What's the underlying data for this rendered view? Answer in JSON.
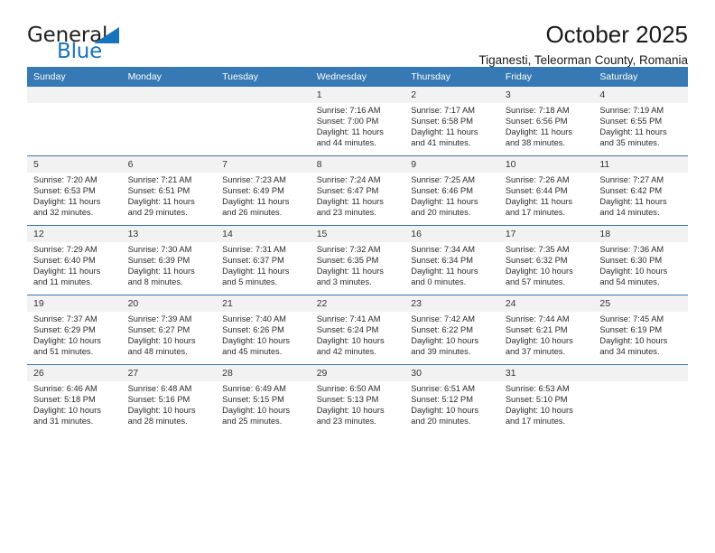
{
  "brand": {
    "name_part1": "General",
    "name_part2": "Blue",
    "accent_color": "#1574bb",
    "triangle_icon": "brand-triangle-icon"
  },
  "header": {
    "month_title": "October 2025",
    "location": "Tiganesti, Teleorman County, Romania"
  },
  "calendar": {
    "header_color": "#3679b4",
    "daynum_band_color": "#f2f2f2",
    "weekday_headers": [
      "Sunday",
      "Monday",
      "Tuesday",
      "Wednesday",
      "Thursday",
      "Friday",
      "Saturday"
    ],
    "weeks": [
      [
        {
          "day": "",
          "empty": true
        },
        {
          "day": "",
          "empty": true
        },
        {
          "day": "",
          "empty": true
        },
        {
          "day": "1",
          "sunrise": "Sunrise: 7:16 AM",
          "sunset": "Sunset: 7:00 PM",
          "daylight": "Daylight: 11 hours and 44 minutes."
        },
        {
          "day": "2",
          "sunrise": "Sunrise: 7:17 AM",
          "sunset": "Sunset: 6:58 PM",
          "daylight": "Daylight: 11 hours and 41 minutes."
        },
        {
          "day": "3",
          "sunrise": "Sunrise: 7:18 AM",
          "sunset": "Sunset: 6:56 PM",
          "daylight": "Daylight: 11 hours and 38 minutes."
        },
        {
          "day": "4",
          "sunrise": "Sunrise: 7:19 AM",
          "sunset": "Sunset: 6:55 PM",
          "daylight": "Daylight: 11 hours and 35 minutes."
        }
      ],
      [
        {
          "day": "5",
          "sunrise": "Sunrise: 7:20 AM",
          "sunset": "Sunset: 6:53 PM",
          "daylight": "Daylight: 11 hours and 32 minutes."
        },
        {
          "day": "6",
          "sunrise": "Sunrise: 7:21 AM",
          "sunset": "Sunset: 6:51 PM",
          "daylight": "Daylight: 11 hours and 29 minutes."
        },
        {
          "day": "7",
          "sunrise": "Sunrise: 7:23 AM",
          "sunset": "Sunset: 6:49 PM",
          "daylight": "Daylight: 11 hours and 26 minutes."
        },
        {
          "day": "8",
          "sunrise": "Sunrise: 7:24 AM",
          "sunset": "Sunset: 6:47 PM",
          "daylight": "Daylight: 11 hours and 23 minutes."
        },
        {
          "day": "9",
          "sunrise": "Sunrise: 7:25 AM",
          "sunset": "Sunset: 6:46 PM",
          "daylight": "Daylight: 11 hours and 20 minutes."
        },
        {
          "day": "10",
          "sunrise": "Sunrise: 7:26 AM",
          "sunset": "Sunset: 6:44 PM",
          "daylight": "Daylight: 11 hours and 17 minutes."
        },
        {
          "day": "11",
          "sunrise": "Sunrise: 7:27 AM",
          "sunset": "Sunset: 6:42 PM",
          "daylight": "Daylight: 11 hours and 14 minutes."
        }
      ],
      [
        {
          "day": "12",
          "sunrise": "Sunrise: 7:29 AM",
          "sunset": "Sunset: 6:40 PM",
          "daylight": "Daylight: 11 hours and 11 minutes."
        },
        {
          "day": "13",
          "sunrise": "Sunrise: 7:30 AM",
          "sunset": "Sunset: 6:39 PM",
          "daylight": "Daylight: 11 hours and 8 minutes."
        },
        {
          "day": "14",
          "sunrise": "Sunrise: 7:31 AM",
          "sunset": "Sunset: 6:37 PM",
          "daylight": "Daylight: 11 hours and 5 minutes."
        },
        {
          "day": "15",
          "sunrise": "Sunrise: 7:32 AM",
          "sunset": "Sunset: 6:35 PM",
          "daylight": "Daylight: 11 hours and 3 minutes."
        },
        {
          "day": "16",
          "sunrise": "Sunrise: 7:34 AM",
          "sunset": "Sunset: 6:34 PM",
          "daylight": "Daylight: 11 hours and 0 minutes."
        },
        {
          "day": "17",
          "sunrise": "Sunrise: 7:35 AM",
          "sunset": "Sunset: 6:32 PM",
          "daylight": "Daylight: 10 hours and 57 minutes."
        },
        {
          "day": "18",
          "sunrise": "Sunrise: 7:36 AM",
          "sunset": "Sunset: 6:30 PM",
          "daylight": "Daylight: 10 hours and 54 minutes."
        }
      ],
      [
        {
          "day": "19",
          "sunrise": "Sunrise: 7:37 AM",
          "sunset": "Sunset: 6:29 PM",
          "daylight": "Daylight: 10 hours and 51 minutes."
        },
        {
          "day": "20",
          "sunrise": "Sunrise: 7:39 AM",
          "sunset": "Sunset: 6:27 PM",
          "daylight": "Daylight: 10 hours and 48 minutes."
        },
        {
          "day": "21",
          "sunrise": "Sunrise: 7:40 AM",
          "sunset": "Sunset: 6:26 PM",
          "daylight": "Daylight: 10 hours and 45 minutes."
        },
        {
          "day": "22",
          "sunrise": "Sunrise: 7:41 AM",
          "sunset": "Sunset: 6:24 PM",
          "daylight": "Daylight: 10 hours and 42 minutes."
        },
        {
          "day": "23",
          "sunrise": "Sunrise: 7:42 AM",
          "sunset": "Sunset: 6:22 PM",
          "daylight": "Daylight: 10 hours and 39 minutes."
        },
        {
          "day": "24",
          "sunrise": "Sunrise: 7:44 AM",
          "sunset": "Sunset: 6:21 PM",
          "daylight": "Daylight: 10 hours and 37 minutes."
        },
        {
          "day": "25",
          "sunrise": "Sunrise: 7:45 AM",
          "sunset": "Sunset: 6:19 PM",
          "daylight": "Daylight: 10 hours and 34 minutes."
        }
      ],
      [
        {
          "day": "26",
          "sunrise": "Sunrise: 6:46 AM",
          "sunset": "Sunset: 5:18 PM",
          "daylight": "Daylight: 10 hours and 31 minutes."
        },
        {
          "day": "27",
          "sunrise": "Sunrise: 6:48 AM",
          "sunset": "Sunset: 5:16 PM",
          "daylight": "Daylight: 10 hours and 28 minutes."
        },
        {
          "day": "28",
          "sunrise": "Sunrise: 6:49 AM",
          "sunset": "Sunset: 5:15 PM",
          "daylight": "Daylight: 10 hours and 25 minutes."
        },
        {
          "day": "29",
          "sunrise": "Sunrise: 6:50 AM",
          "sunset": "Sunset: 5:13 PM",
          "daylight": "Daylight: 10 hours and 23 minutes."
        },
        {
          "day": "30",
          "sunrise": "Sunrise: 6:51 AM",
          "sunset": "Sunset: 5:12 PM",
          "daylight": "Daylight: 10 hours and 20 minutes."
        },
        {
          "day": "31",
          "sunrise": "Sunrise: 6:53 AM",
          "sunset": "Sunset: 5:10 PM",
          "daylight": "Daylight: 10 hours and 17 minutes."
        },
        {
          "day": "",
          "empty": true
        }
      ]
    ]
  }
}
